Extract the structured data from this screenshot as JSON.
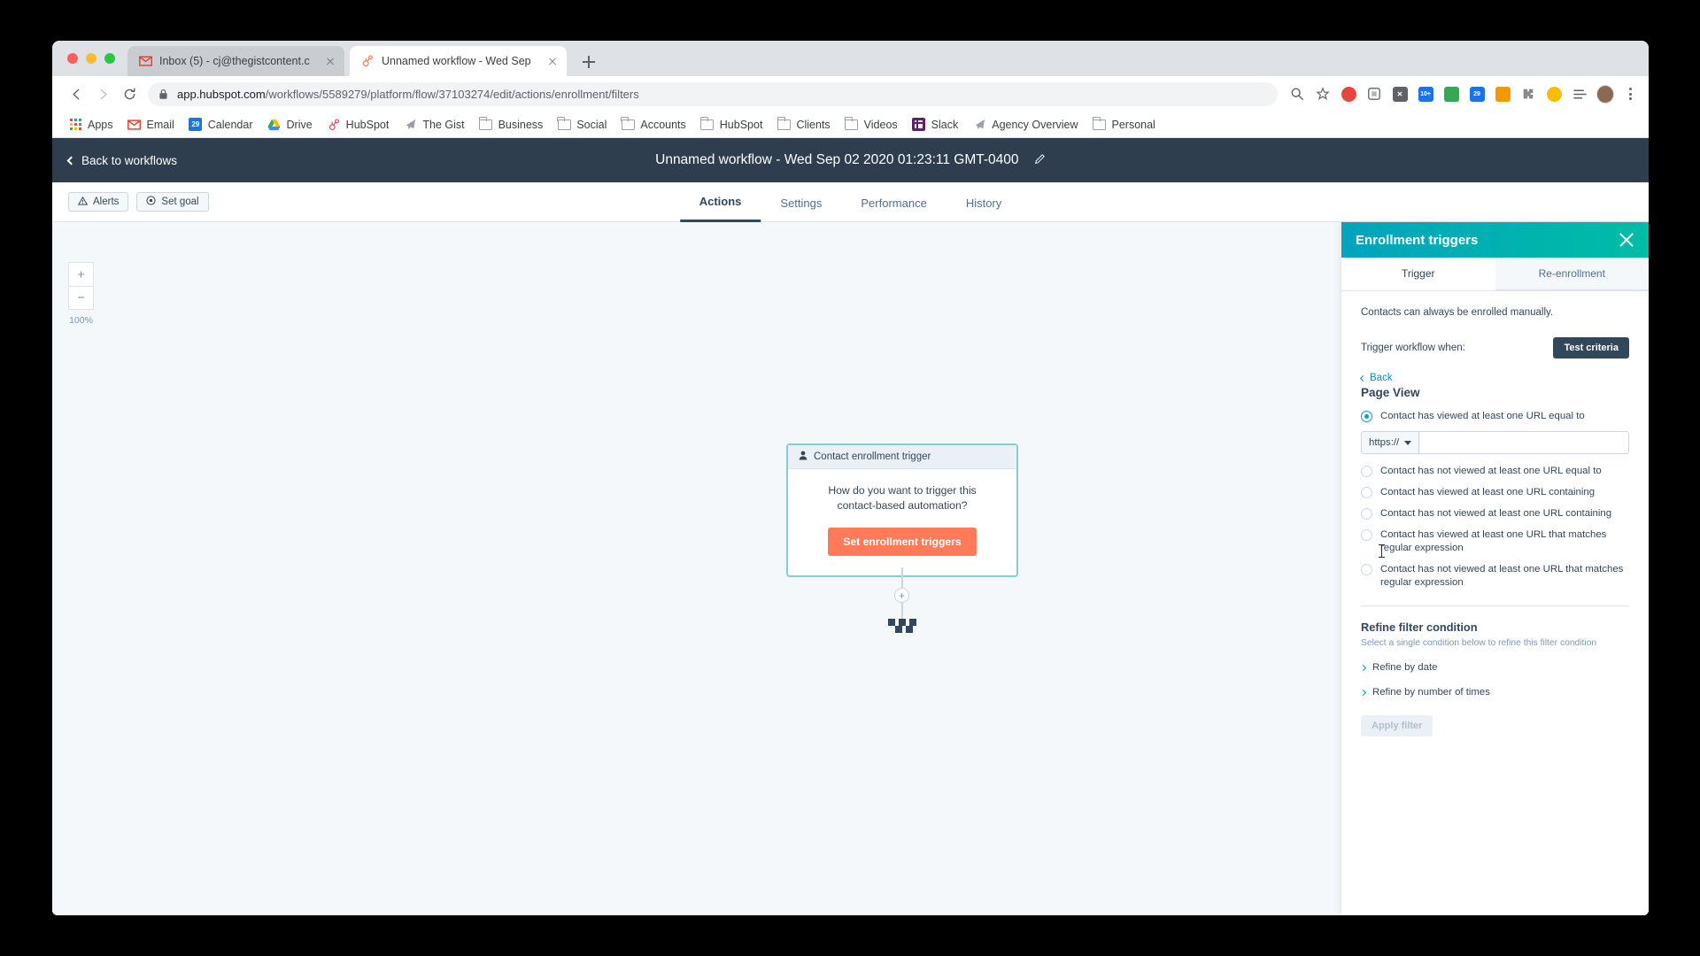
{
  "browser": {
    "tabs": [
      {
        "title": "Inbox (5) - cj@thegistcontent.c",
        "favicon": "gmail-icon",
        "active": false
      },
      {
        "title": "Unnamed workflow - Wed Sep",
        "favicon": "hubspot-icon",
        "active": true
      }
    ],
    "newtab_label": "+",
    "url_domain": "app.hubspot.com",
    "url_path": "/workflows/5589279/platform/flow/37103274/edit/actions/enrollment/filters",
    "toolbar_icons": [
      "back-icon",
      "forward-icon",
      "reload-icon",
      "lock-icon",
      "search-icon",
      "star-icon",
      "extension-record-icon",
      "extension-puzzle-icon",
      "extension-x-icon",
      "extension-count-10-icon",
      "extension-green-icon",
      "extension-blue-29-icon",
      "extension-orange-icon",
      "extension-puzzle2-icon",
      "extension-yellow-icon",
      "reading-list-icon",
      "profile-avatar",
      "menu-kebab-icon"
    ],
    "badges": {
      "ten_plus": "10+",
      "twenty_nine": "29"
    },
    "bookmarks": [
      {
        "label": "Apps",
        "icon": "apps-grid-icon"
      },
      {
        "label": "Email",
        "icon": "gmail-icon"
      },
      {
        "label": "Calendar",
        "icon": "calendar-29-icon"
      },
      {
        "label": "Drive",
        "icon": "drive-icon"
      },
      {
        "label": "HubSpot",
        "icon": "hubspot-icon"
      },
      {
        "label": "The Gist",
        "icon": "gist-icon"
      },
      {
        "label": "Business",
        "icon": "folder-icon"
      },
      {
        "label": "Social",
        "icon": "folder-icon"
      },
      {
        "label": "Accounts",
        "icon": "folder-icon"
      },
      {
        "label": "HubSpot",
        "icon": "folder-icon"
      },
      {
        "label": "Clients",
        "icon": "folder-icon"
      },
      {
        "label": "Videos",
        "icon": "folder-icon"
      },
      {
        "label": "Slack",
        "icon": "slack-icon"
      },
      {
        "label": "Agency Overview",
        "icon": "gist-icon"
      },
      {
        "label": "Personal",
        "icon": "folder-icon"
      }
    ]
  },
  "app": {
    "back_label": "Back to workflows",
    "workflow_title": "Unnamed workflow - Wed Sep 02 2020 01:23:11 GMT-0400",
    "edit_icon": "pencil-icon",
    "toolbar_buttons": [
      {
        "label": "Alerts",
        "icon": "alert-triangle-icon"
      },
      {
        "label": "Set goal",
        "icon": "target-icon"
      }
    ],
    "tabs": [
      {
        "label": "Actions",
        "active": true
      },
      {
        "label": "Settings",
        "active": false
      },
      {
        "label": "Performance",
        "active": false
      },
      {
        "label": "History",
        "active": false
      }
    ],
    "zoom": {
      "in": "+",
      "out": "−",
      "level": "100%"
    },
    "node": {
      "header": "Contact enrollment trigger",
      "header_icon": "contact-person-icon",
      "question": "How do you want to trigger this contact-based automation?",
      "cta_label": "Set enrollment triggers",
      "cta_color": "#ff7a59"
    },
    "plus_node_label": "+"
  },
  "panel": {
    "title": "Enrollment triggers",
    "close_icon": "close-icon",
    "accent_from": "#00a4bd",
    "accent_to": "#00bda5",
    "tabs": [
      {
        "label": "Trigger",
        "active": true
      },
      {
        "label": "Re-enrollment",
        "active": false
      }
    ],
    "note": "Contacts can always be enrolled manually.",
    "trigger_label": "Trigger workflow when:",
    "test_criteria_label": "Test criteria",
    "back_label": "Back",
    "filter_type": "Page View",
    "options": [
      {
        "label": "Contact has viewed at least one URL equal to",
        "selected": true
      },
      {
        "label": "Contact has not viewed at least one URL equal to",
        "selected": false
      },
      {
        "label": "Contact has viewed at least one URL containing",
        "selected": false
      },
      {
        "label": "Contact has not viewed at least one URL containing",
        "selected": false
      },
      {
        "label": "Contact has viewed at least one URL that matches regular expression",
        "selected": false
      },
      {
        "label": "Contact has not viewed at least one URL that matches regular expression",
        "selected": false
      }
    ],
    "url_protocol": "https://",
    "url_value": "",
    "url_placeholder": "",
    "refine_title": "Refine filter condition",
    "refine_subtitle": "Select a single condition below to refine this filter condition",
    "refine_items": [
      {
        "label": "Refine by date"
      },
      {
        "label": "Refine by number of times"
      }
    ],
    "apply_label": "Apply filter"
  }
}
